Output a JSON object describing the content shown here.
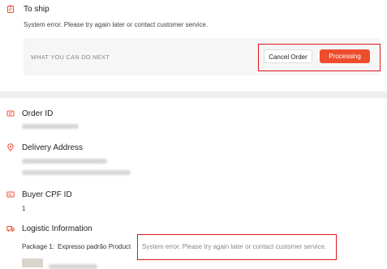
{
  "status": {
    "title": "To ship",
    "message": "System error. Please try again later or contact customer service."
  },
  "next_actions": {
    "label": "WHAT YOU CAN DO NEXT",
    "cancel_label": "Cancel Order",
    "processing_label": "Processing"
  },
  "order": {
    "label": "Order ID"
  },
  "delivery": {
    "label": "Delivery Address"
  },
  "buyer": {
    "label": "Buyer CPF ID",
    "value": "1"
  },
  "logistics": {
    "label": "Logistic Information",
    "package_label": "Package 1:",
    "package_method": "Expresso padrão Product",
    "error": "System error. Please try again later or contact customer service."
  },
  "colors": {
    "accent": "#ee4d2d",
    "highlight_border": "#e0141e",
    "panel_bg": "#f6f6f6",
    "divider": "#eeeeee"
  },
  "icons": [
    "clipboard-icon",
    "order-id-icon",
    "location-pin-icon",
    "id-card-icon",
    "truck-icon"
  ]
}
